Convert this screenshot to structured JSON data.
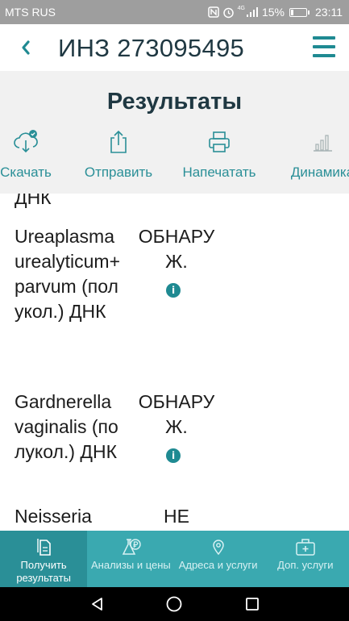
{
  "status_bar": {
    "carrier": "MTS RUS",
    "network": "4G",
    "battery_percent": "15%",
    "battery_level": 0.15,
    "time": "23:11"
  },
  "app_bar": {
    "back_icon": "chevron-left-icon",
    "title": "ИНЗ 273095495",
    "menu_icon": "hamburger-menu-icon"
  },
  "results_header": {
    "title": "Результаты",
    "actions": [
      {
        "label": "Скачать",
        "icon": "cloud-download-icon"
      },
      {
        "label": "Отправить",
        "icon": "share-icon"
      },
      {
        "label": "Напечатать",
        "icon": "printer-icon"
      },
      {
        "label": "Динамика",
        "icon": "bar-chart-icon"
      }
    ]
  },
  "results": [
    {
      "name": "ДНК",
      "result": ""
    },
    {
      "name": "Ureaplasma urealyticum+parvum (полукол.) ДНК",
      "result": "ОБНАРУЖ.",
      "info": true
    },
    {
      "name": "Gardnerella vaginalis (полукол.) ДНК",
      "result": "ОБНАРУЖ.",
      "info": true
    },
    {
      "name": "Neisseria",
      "result": "НЕ"
    }
  ],
  "bottom_nav": [
    {
      "label": "Получить результаты",
      "icon": "document-icon",
      "active": true
    },
    {
      "label": "Анализы и цены",
      "icon": "flask-ruble-icon",
      "active": false
    },
    {
      "label": "Адреса и услуги",
      "icon": "map-pin-icon",
      "active": false
    },
    {
      "label": "Доп. услуги",
      "icon": "medical-kit-icon",
      "active": false
    }
  ],
  "colors": {
    "accent": "#1f8a92",
    "nav_bg": "#3aa9b0",
    "nav_active": "#2a8f97",
    "title_text": "#1f3842",
    "status_bar": "#9e9e9e"
  }
}
